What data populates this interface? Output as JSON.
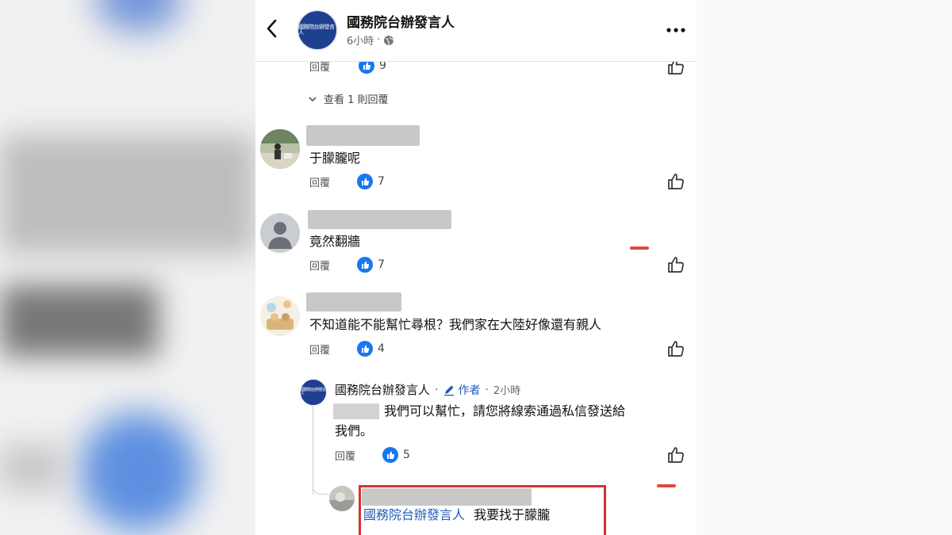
{
  "header": {
    "page_name": "國務院台辦發言人",
    "time": "6小時",
    "dot": "·",
    "avatar_text": "國務院台辦發言人"
  },
  "top_reply_row": {
    "reply_label": "回覆",
    "like_count": "9"
  },
  "view_replies": {
    "label": "查看 1 則回覆"
  },
  "comments": [
    {
      "text": "于朦朧呢",
      "reply_label": "回覆",
      "like_count": "7"
    },
    {
      "text": "竟然翻牆",
      "reply_label": "回覆",
      "like_count": "7"
    },
    {
      "text": "不知道能不能幫忙尋根？我們家在大陸好像還有親人",
      "reply_label": "回覆",
      "like_count": "4"
    }
  ],
  "author_reply": {
    "name": "國務院台辦發言人",
    "dot1": "·",
    "author_tag": "作者",
    "dot2": "·",
    "time": "2小時",
    "text_line1": "我們可以幫忙，請您將線索通過私信發送給",
    "text_line2": "我們。",
    "reply_label": "回覆",
    "like_count": "5"
  },
  "nested_reply": {
    "mention": "國務院台辦發言人",
    "text": "我要找于朦朧"
  },
  "colors": {
    "like_blue": "#1877f2",
    "mention_blue": "#1e5bb8",
    "highlight_red": "#d9302e",
    "avatar_navy": "#1f3f8f"
  },
  "icons": [
    "back-arrow-icon",
    "globe-icon",
    "more-dots-icon",
    "like-badge-icon",
    "like-outline-icon",
    "chevron-down-icon",
    "pencil-icon"
  ]
}
